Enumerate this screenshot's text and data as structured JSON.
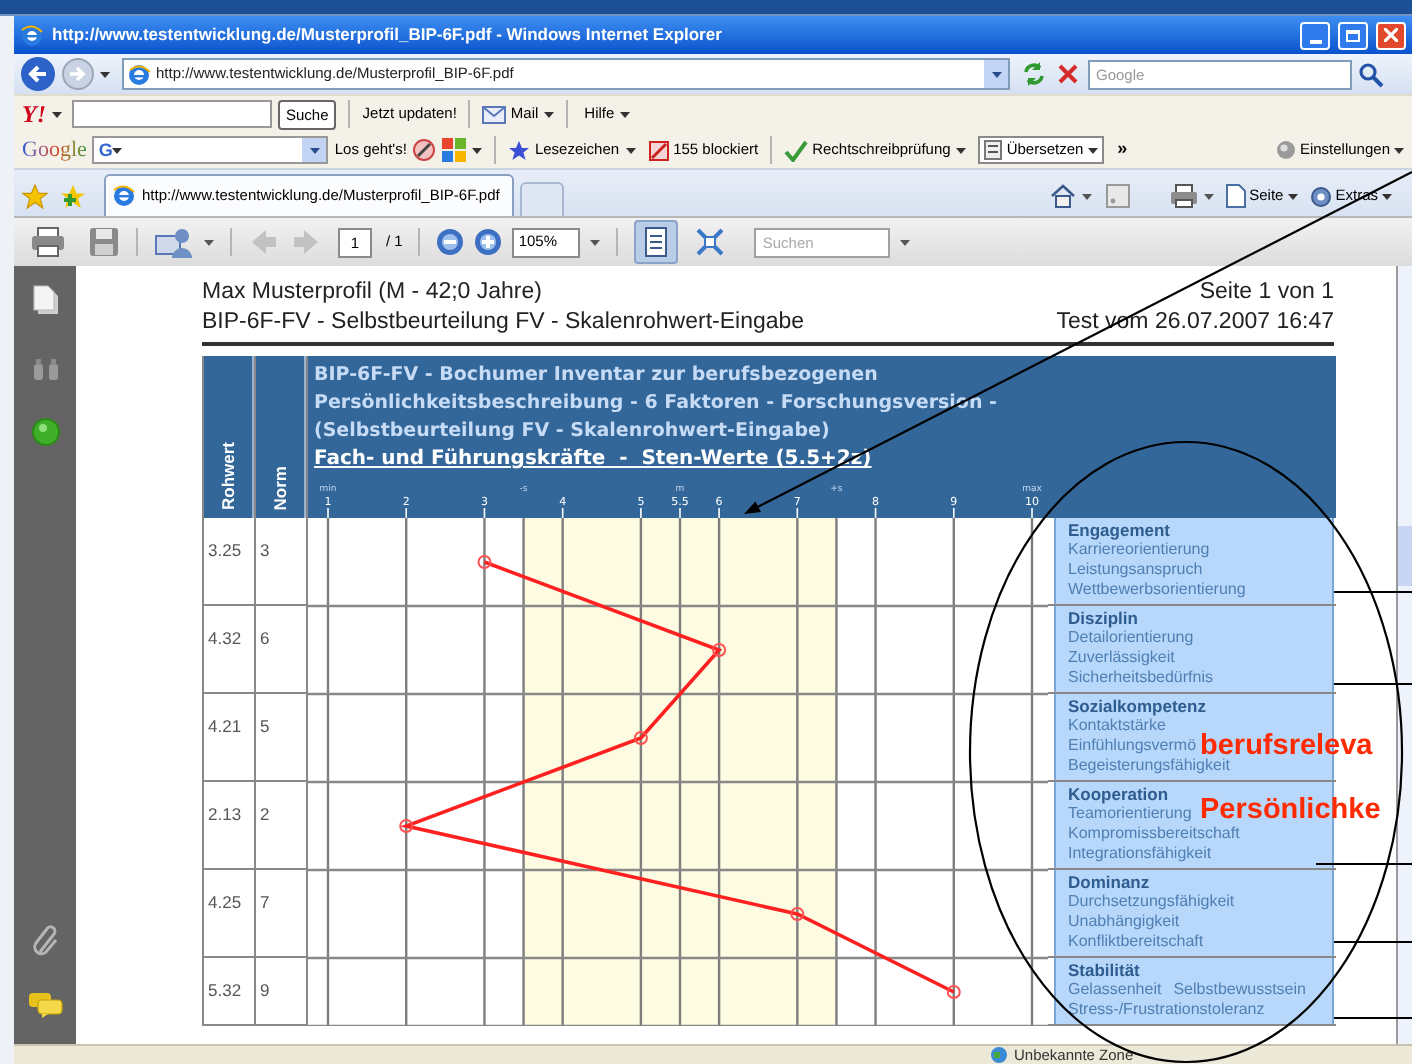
{
  "window": {
    "title": "http://www.testentwicklung.de/Musterprofil_BIP-6F.pdf - Windows Internet Explorer"
  },
  "address_bar": {
    "url": "http://www.testentwicklung.de/Musterprofil_BIP-6F.pdf",
    "search_placeholder": "Google"
  },
  "yahoo_toolbar": {
    "logo": "Y!",
    "search_button": "Suche",
    "update": "Jetzt updaten!",
    "mail": "Mail",
    "help": "Hilfe"
  },
  "google_toolbar": {
    "logo": "Google",
    "field_logo": "G",
    "go": "Los geht's!",
    "bookmarks": "Lesezeichen",
    "blocked": "155 blockiert",
    "spelling": "Rechtschreibprüfung",
    "translate": "Übersetzen",
    "more": "»",
    "settings": "Einstellungen"
  },
  "tabs": [
    {
      "label": "http://www.testentwicklung.de/Musterprofil_BIP-6F.pdf",
      "selected": true
    }
  ],
  "command_bar": {
    "page": "Seite",
    "tools": "Extras"
  },
  "pdf_toolbar": {
    "page_navigation": [
      {
        "kind": "previous",
        "disabled": true
      },
      {
        "kind": "next",
        "disabled": true
      }
    ],
    "page": "1",
    "page_count": "/ 1",
    "zoom": "105%",
    "view_buttons": [
      {
        "kind": "fit_page",
        "selected": true
      },
      {
        "kind": "fit_width",
        "selected": false
      }
    ],
    "search_placeholder": "Suchen"
  },
  "document": {
    "header_left": [
      "Max Musterprofil (M - 42;0 Jahre)",
      "BIP-6F-FV - Selbstbeurteilung FV - Skalenrohwert-Eingabe"
    ],
    "header_right": [
      "Seite 1 von 1",
      "Test vom 26.07.2007 16:47"
    ],
    "table": {
      "columns": [
        "Rohwert",
        "Norm"
      ],
      "title_lines": [
        "BIP-6F-FV - Bochumer Inventar zur berufsbezogenen",
        "Persönlichkeitsbeschreibung - 6 Faktoren - Forschungsversion -",
        "(Selbstbeurteilung FV - Skalenrohwert-Eingabe)"
      ],
      "subtitle": "Fach- und Führungskräfte  -  Sten-Werte (5.5+2z)",
      "scale_markers": [
        "min",
        "-s",
        "m",
        "+s",
        "max"
      ],
      "rows": [
        {
          "rohwert": "3.25",
          "norm": "3",
          "factor": "Engagement",
          "facet_lines": [
            [
              "Karriereorientierung"
            ],
            [
              "Leistungsanspruch"
            ],
            [
              "Wettbewerbsorientierung"
            ]
          ]
        },
        {
          "rohwert": "4.32",
          "norm": "6",
          "factor": "Disziplin",
          "facet_lines": [
            [
              "Detailorientierung"
            ],
            [
              "Zuverlässigkeit"
            ],
            [
              "Sicherheitsbedürfnis"
            ]
          ]
        },
        {
          "rohwert": "4.21",
          "norm": "5",
          "factor": "Sozialkompetenz",
          "facet_lines": [
            [
              "Kontaktstärke"
            ],
            [
              "Einfühlungsvermö"
            ],
            [
              "Begeisterungsfähigkeit"
            ]
          ]
        },
        {
          "rohwert": "2.13",
          "norm": "2",
          "factor": "Kooperation",
          "facet_lines": [
            [
              "Teamorientierung"
            ],
            [
              "Kompromissbereitschaft"
            ],
            [
              "Integrationsfähigkeit"
            ]
          ]
        },
        {
          "rohwert": "4.25",
          "norm": "7",
          "factor": "Dominanz",
          "facet_lines": [
            [
              "Durchsetzungsfähigkeit"
            ],
            [
              "Unabhängigkeit"
            ],
            [
              "Konfliktbereitschaft"
            ]
          ]
        },
        {
          "rohwert": "5.32",
          "norm": "9",
          "factor": "Stabilität",
          "facet_lines": [
            [
              "Gelassenheit",
              "Selbstbewusstsein"
            ],
            [
              "Stress-/Frustrationstoleranz"
            ]
          ]
        }
      ]
    },
    "chart_data": {
      "type": "line",
      "orientation": "horizontal",
      "values": [
        3,
        6,
        5,
        2,
        7,
        9
      ],
      "xlim": [
        1,
        10
      ],
      "xticks": [
        1,
        2,
        3,
        4,
        5,
        {
          "value": 5.5,
          "label": "5.5"
        },
        6,
        7,
        8,
        9,
        10
      ],
      "grid": true,
      "marker": "o"
    }
  },
  "callout_labels": [
    "berufsreleva",
    "Persönlichke"
  ],
  "status_bar": {
    "zone": "Unbekannte Zone"
  }
}
